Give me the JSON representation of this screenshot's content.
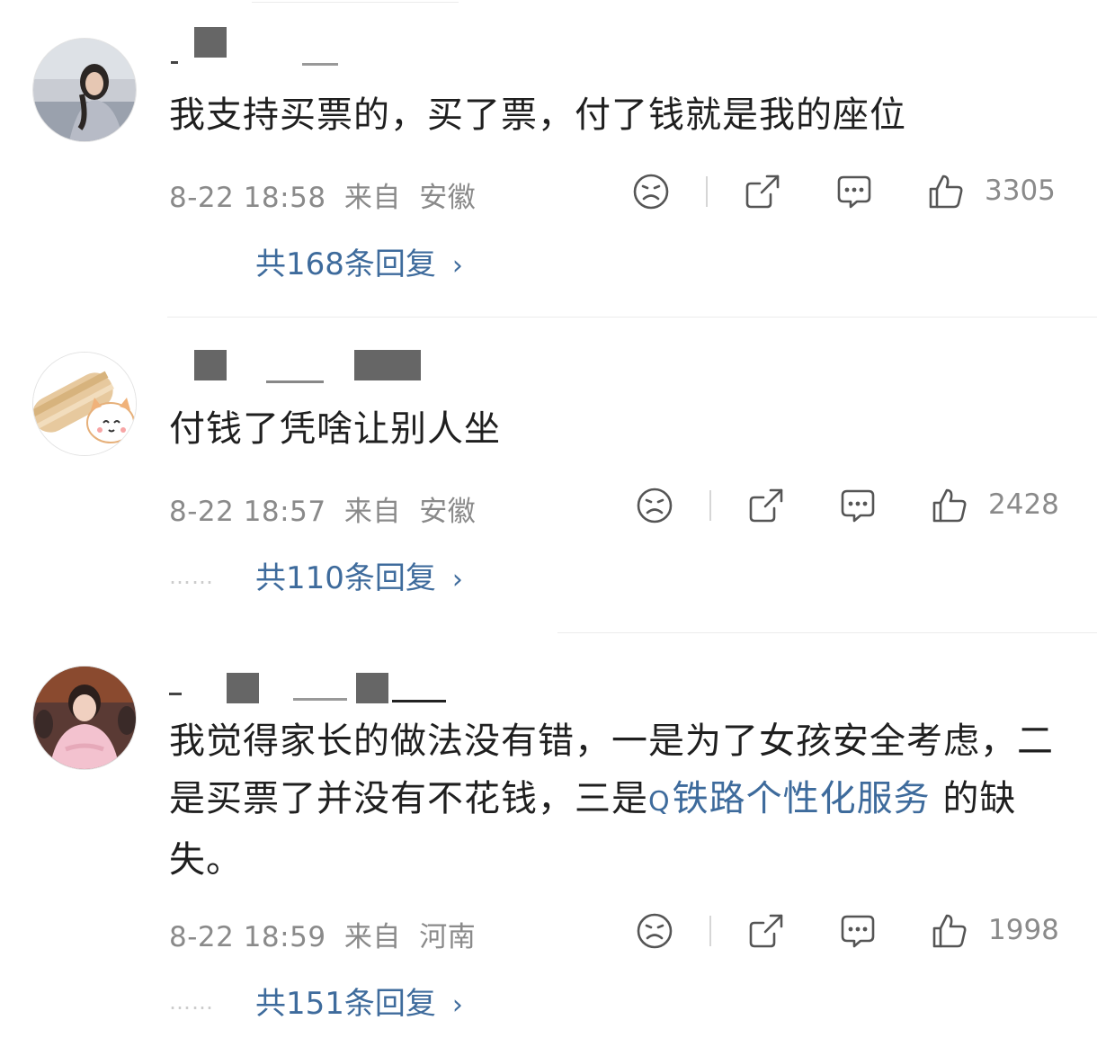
{
  "comments": [
    {
      "text": "我支持买票的，买了票，付了钱就是我的座位",
      "date": "8-22 18:58",
      "from_label": "来自",
      "location": "安徽",
      "likes": "3305",
      "reply_text": "共168条回复",
      "dots": ""
    },
    {
      "text": "付钱了凭啥让别人坐",
      "date": "8-22 18:57",
      "from_label": "来自",
      "location": "安徽",
      "likes": "2428",
      "reply_text": "共110条回复",
      "dots": "……"
    },
    {
      "text_before": "我觉得家长的做法没有错，一是为了女孩安全考虑，二是买票了并没有不花钱，三是",
      "topic": "铁路个性化服务",
      "text_after": " 的缺失。",
      "date": "8-22 18:59",
      "from_label": "来自",
      "location": "河南",
      "likes": "1998",
      "reply_text": "共151条回复",
      "dots": "……"
    }
  ],
  "icons": {
    "dislike": "sad-face-icon",
    "share": "share-icon",
    "comment": "comment-icon",
    "like": "thumbs-up-icon",
    "reply_arrow": "chevron-right-icon",
    "topic": "search-icon"
  },
  "colors": {
    "link": "#3e6b9c",
    "meta": "#8a8a8a",
    "text": "#1f1f1f",
    "divider": "#ececec"
  }
}
